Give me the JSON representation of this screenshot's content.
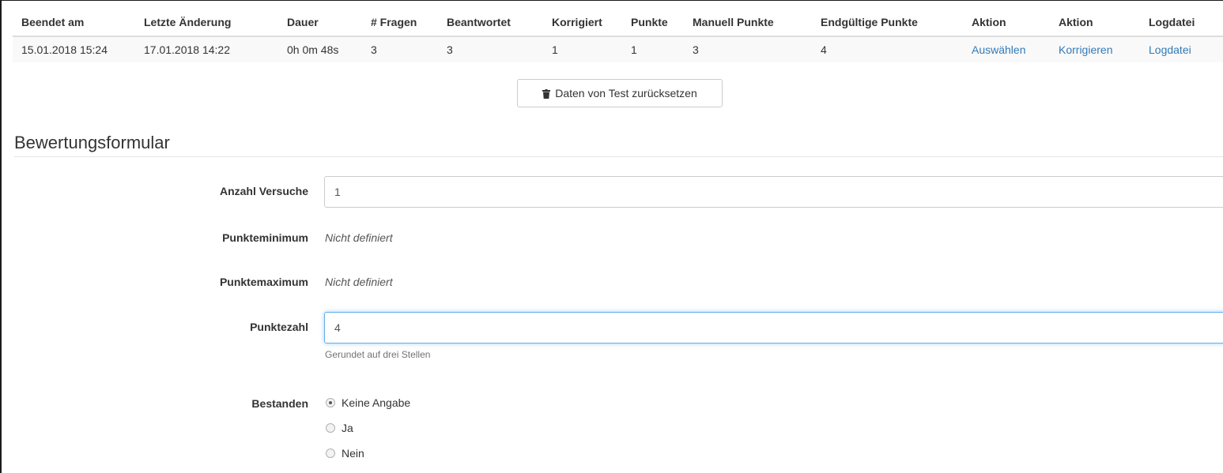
{
  "table": {
    "headers": [
      "Beendet am",
      "Letzte Änderung",
      "Dauer",
      "# Fragen",
      "Beantwortet",
      "Korrigiert",
      "Punkte",
      "Manuell Punkte",
      "Endgültige Punkte",
      "Aktion",
      "Aktion",
      "Logdatei"
    ],
    "row": {
      "finished": "15.01.2018 15:24",
      "last_change": "17.01.2018 14:22",
      "duration": "0h 0m 48s",
      "questions": "3",
      "answered": "3",
      "corrected": "1",
      "points": "1",
      "manual_points": "3",
      "final_points": "4",
      "select_link": "Auswählen",
      "correct_link": "Korrigieren",
      "log_link": "Logdatei"
    }
  },
  "reset_button": {
    "label": "Daten von Test zurücksetzen",
    "icon": "trash-icon"
  },
  "form": {
    "title": "Bewertungsformular",
    "attempts": {
      "label": "Anzahl Versuche",
      "value": "1"
    },
    "min_points": {
      "label": "Punkteminimum",
      "value": "Nicht definiert"
    },
    "max_points": {
      "label": "Punktemaximum",
      "value": "Nicht definiert"
    },
    "score": {
      "label": "Punktezahl",
      "value": "4",
      "help": "Gerundet auf drei Stellen"
    },
    "passed": {
      "label": "Bestanden",
      "options": [
        "Keine Angabe",
        "Ja",
        "Nein"
      ],
      "selected": "Keine Angabe"
    }
  },
  "colors": {
    "link": "#337ab7",
    "focus": "#66afe9"
  }
}
